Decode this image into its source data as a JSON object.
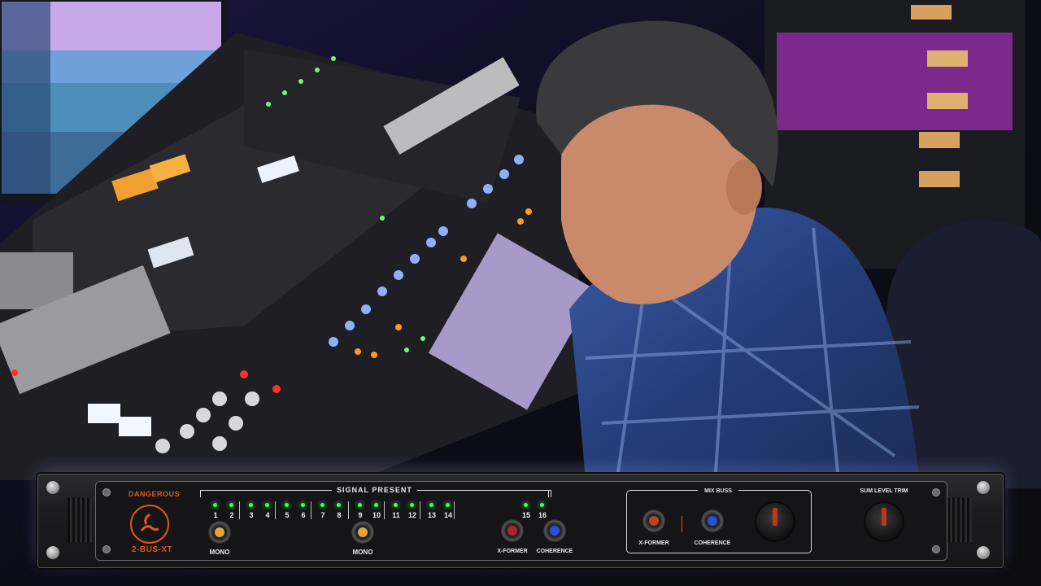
{
  "panel": {
    "brand_top": "DANGEROUS",
    "brand_bottom": "2-BUS-XT",
    "signal_present": "SIGNAL PRESENT",
    "channels": [
      "1",
      "2",
      "3",
      "4",
      "5",
      "6",
      "7",
      "8",
      "9",
      "10",
      "11",
      "12",
      "13",
      "14"
    ],
    "ch15": "15",
    "ch16": "16",
    "mono1": "MONO",
    "mono2": "MONO",
    "xformer": "X-FORMER",
    "coherence": "COHERENCE",
    "mix_buss": "MIX BUSS",
    "mix_xformer": "X-FORMER",
    "mix_coherence": "COHERENCE",
    "sum_level_trim": "SUM LEVEL TRIM"
  },
  "colors": {
    "accent_orange": "#e0571c",
    "led_green": "#3cff5a",
    "cap_amber": "#e6a53a",
    "cap_red": "#a8282e",
    "cap_blue": "#2a4fd8"
  }
}
